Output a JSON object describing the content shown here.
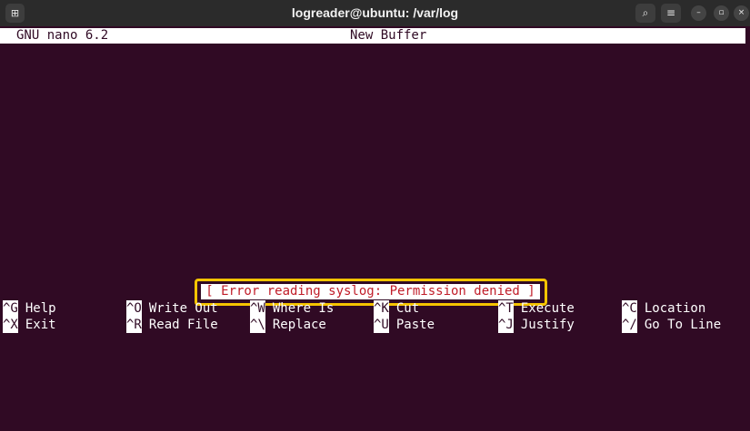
{
  "window": {
    "title": "logreader@ubuntu: /var/log",
    "new_tab_glyph": "⊞",
    "search_glyph": "⌕",
    "menu_glyph": "≡",
    "minimize_glyph": "–",
    "maximize_glyph": "▫",
    "close_glyph": "×"
  },
  "nano": {
    "version": "GNU nano 6.2",
    "buffer_name": "New Buffer",
    "status_message": "[ Error reading syslog: Permission denied ]"
  },
  "shortcuts": {
    "row1": [
      {
        "key": "^G",
        "label": "Help"
      },
      {
        "key": "^O",
        "label": "Write Out"
      },
      {
        "key": "^W",
        "label": "Where Is"
      },
      {
        "key": "^K",
        "label": "Cut"
      },
      {
        "key": "^T",
        "label": "Execute"
      },
      {
        "key": "^C",
        "label": "Location"
      }
    ],
    "row2": [
      {
        "key": "^X",
        "label": "Exit"
      },
      {
        "key": "^R",
        "label": "Read File"
      },
      {
        "key": "^\\",
        "label": "Replace"
      },
      {
        "key": "^U",
        "label": "Paste"
      },
      {
        "key": "^J",
        "label": "Justify"
      },
      {
        "key": "^/",
        "label": "Go To Line"
      }
    ]
  },
  "colors": {
    "terminal_bg": "#300a24",
    "titlebar_bg": "#2b2b2b",
    "error_text": "#c01c28",
    "highlight_border": "#f5c400"
  }
}
